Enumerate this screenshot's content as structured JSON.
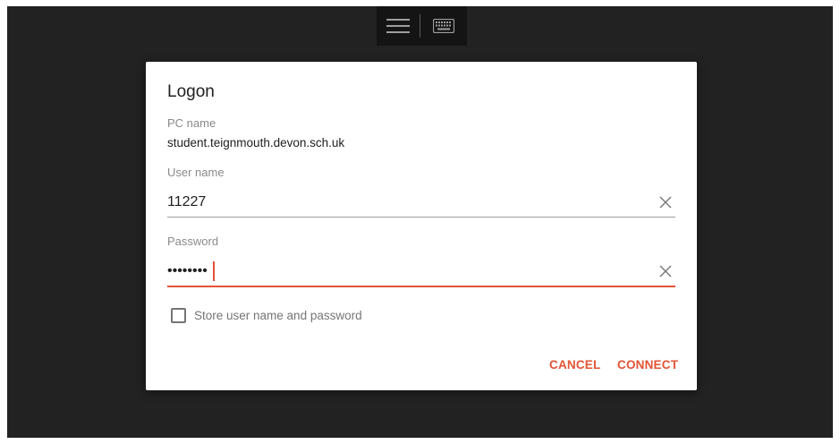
{
  "toolbar": {
    "menu_icon": "hamburger-menu-icon",
    "keyboard_icon": "keyboard-icon"
  },
  "dialog": {
    "title": "Logon",
    "pc_name_label": "PC name",
    "pc_name_value": "student.teignmouth.devon.sch.uk",
    "username_label": "User name",
    "username_value": "11227",
    "password_label": "Password",
    "password_value": "••••••••",
    "store_checkbox_label": "Store user name and password",
    "store_checkbox_checked": false,
    "cancel_label": "CANCEL",
    "connect_label": "CONNECT"
  },
  "colors": {
    "accent": "#e25335",
    "background": "#222222",
    "dialog_background": "#ffffff"
  }
}
